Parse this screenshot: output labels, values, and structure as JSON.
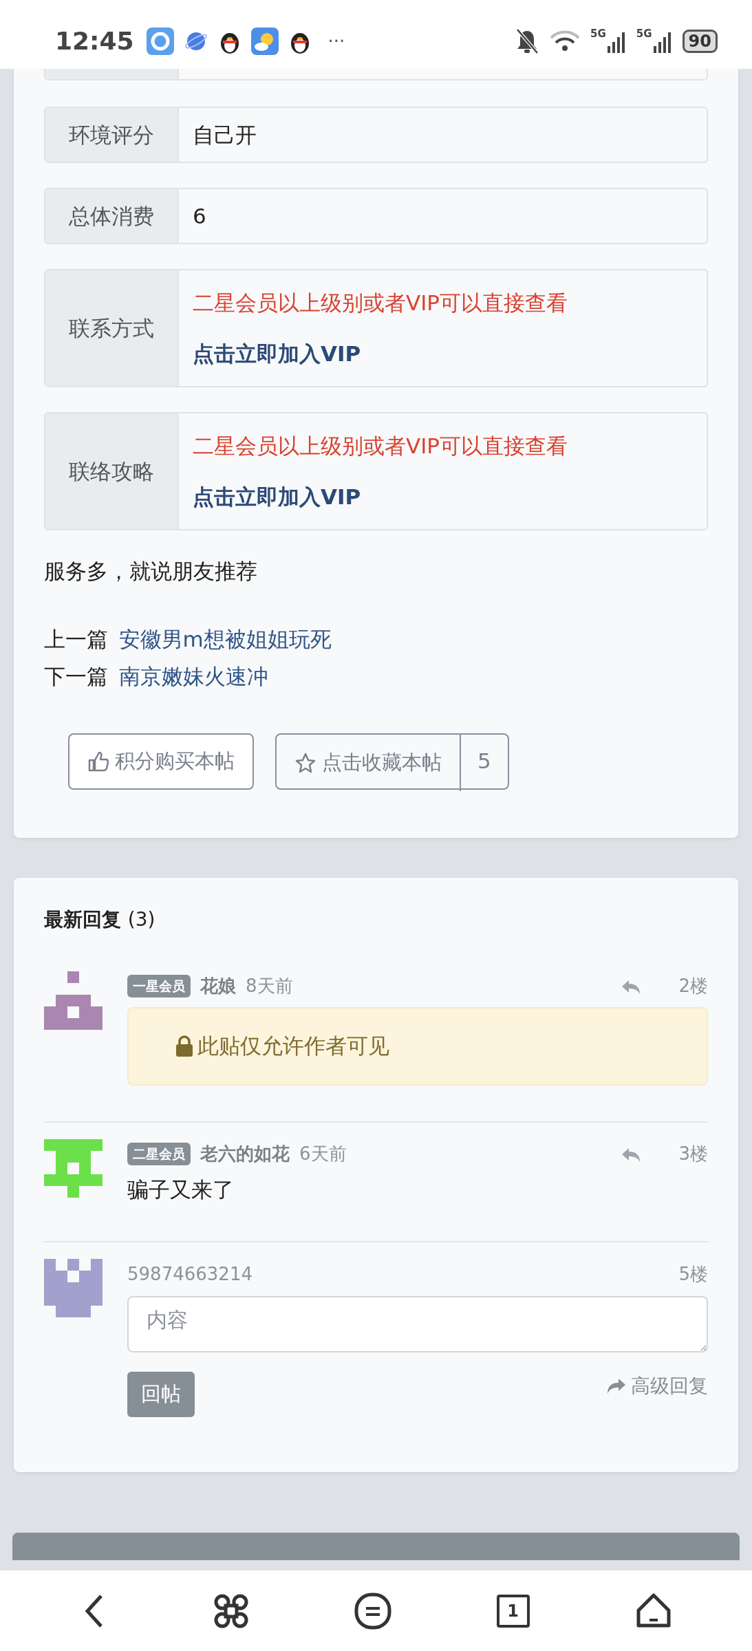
{
  "status_bar": {
    "time": "12:45",
    "more": "···",
    "networks": [
      "5G",
      "5G"
    ],
    "battery": "90"
  },
  "fields": [
    {
      "label": "环境评分",
      "kind": "text",
      "value": "自己开"
    },
    {
      "label": "总体消费",
      "kind": "text",
      "value": "6"
    },
    {
      "label": "联系方式",
      "kind": "locked",
      "notice": "二星会员以上级别或者VIP可以直接查看",
      "link": "点击立即加入VIP"
    },
    {
      "label": "联络攻略",
      "kind": "locked",
      "notice": "二星会员以上级别或者VIP可以直接查看",
      "link": "点击立即加入VIP"
    }
  ],
  "body": "服务多，就说朋友推荐",
  "nav_links": [
    {
      "label": "上一篇",
      "title": "安徽男m想被姐姐玩死"
    },
    {
      "label": "下一篇",
      "title": "南京嫩妹火速冲"
    }
  ],
  "actions": {
    "buy": "积分购买本帖",
    "favorite": "点击收藏本帖",
    "favorite_count": "5"
  },
  "replies": {
    "title": "最新回复",
    "count": "(3)",
    "items": [
      {
        "badge": "一星会员",
        "author": "花娘",
        "time": "8天前",
        "floor": "2楼",
        "color": "#a987b0",
        "kind": "locked",
        "content": "此贴仅允许作者可见"
      },
      {
        "badge": "二星会员",
        "author": "老六的如花",
        "time": "6天前",
        "floor": "3楼",
        "color": "#6be04b",
        "kind": "text",
        "content": "骗子又来了"
      }
    ]
  },
  "reply_form": {
    "user": "59874663214",
    "floor": "5楼",
    "color": "#a2a0cc",
    "placeholder": "内容",
    "submit": "回帖",
    "advanced": "高级回复"
  },
  "bottom_nav": {
    "tab_count": "1"
  }
}
